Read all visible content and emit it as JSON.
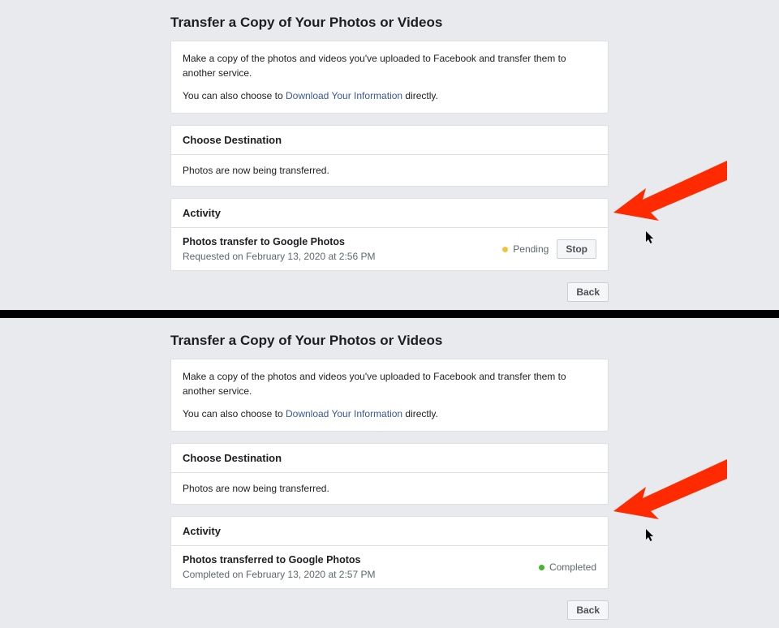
{
  "top": {
    "page_title": "Transfer a Copy of Your Photos or Videos",
    "intro1": "Make a copy of the photos and videos you've uploaded to Facebook and transfer them to another service.",
    "intro2_prefix": "You can also choose to ",
    "download_link": "Download Your Information",
    "intro2_suffix": " directly.",
    "choose_header": "Choose Destination",
    "choose_body": "Photos are now being transferred.",
    "activity_header": "Activity",
    "activity_title": "Photos transfer to Google Photos",
    "activity_sub": "Requested on February 13, 2020 at 2:56 PM",
    "status_label": "Pending",
    "stop_label": "Stop",
    "back_label": "Back"
  },
  "bottom": {
    "page_title": "Transfer a Copy of Your Photos or Videos",
    "intro1": "Make a copy of the photos and videos you've uploaded to Facebook and transfer them to another service.",
    "intro2_prefix": "You can also choose to ",
    "download_link": "Download Your Information",
    "intro2_suffix": " directly.",
    "choose_header": "Choose Destination",
    "choose_body": "Photos are now being transferred.",
    "activity_header": "Activity",
    "activity_title": "Photos transferred to Google Photos",
    "activity_sub": "Completed on February 13, 2020 at 2:57 PM",
    "status_label": "Completed",
    "back_label": "Back"
  },
  "colors": {
    "pending_dot": "#f5c33b",
    "completed_dot": "#42b72a",
    "link": "#385898",
    "arrow": "#ff2a00"
  }
}
